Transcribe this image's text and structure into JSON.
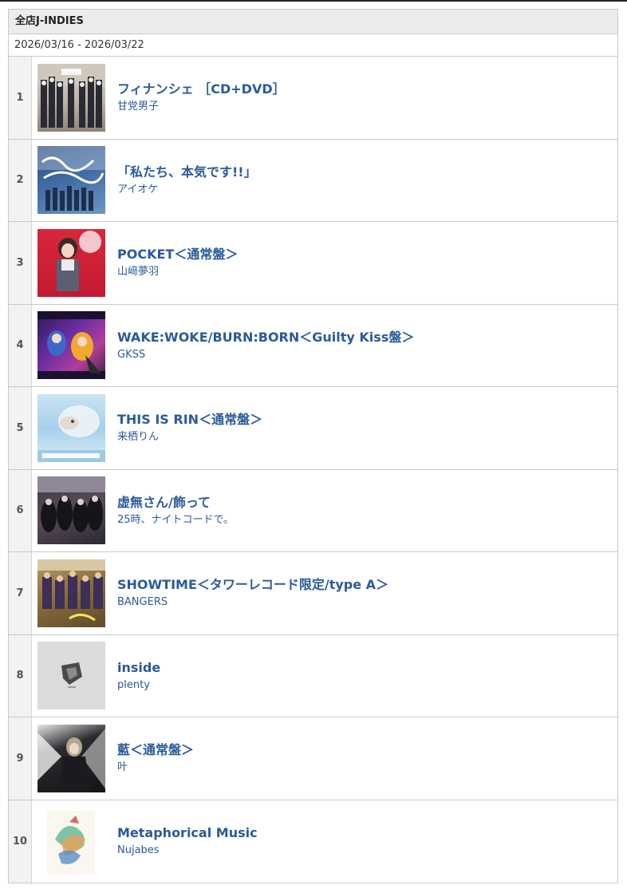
{
  "header": {
    "title": "全店J-INDIES",
    "date_range": "2026/03/16 - 2026/03/22"
  },
  "ranking": [
    {
      "rank": "1",
      "title": "フィナンシェ ［CD+DVD］",
      "artist": "甘党男子",
      "cover_icon": "album-cover-image"
    },
    {
      "rank": "2",
      "title": "「私たち、本気です!!」",
      "artist": "アイオケ",
      "cover_icon": "album-cover-image"
    },
    {
      "rank": "3",
      "title": "POCKET＜通常盤＞",
      "artist": "山﨑夢羽",
      "cover_icon": "album-cover-image"
    },
    {
      "rank": "4",
      "title": "WAKE:WOKE/BURN:BORN＜Guilty Kiss盤＞",
      "artist": "GKSS",
      "cover_icon": "album-cover-image"
    },
    {
      "rank": "5",
      "title": "THIS IS RIN＜通常盤＞",
      "artist": "来栖りん",
      "cover_icon": "album-cover-image"
    },
    {
      "rank": "6",
      "title": "虚無さん/飾って",
      "artist": "25時、ナイトコードで。",
      "cover_icon": "album-cover-image"
    },
    {
      "rank": "7",
      "title": "SHOWTIME＜タワーレコード限定/type A＞",
      "artist": "BANGERS",
      "cover_icon": "album-cover-image"
    },
    {
      "rank": "8",
      "title": "inside",
      "artist": "plenty",
      "cover_icon": "album-cover-image"
    },
    {
      "rank": "9",
      "title": "藍＜通常盤＞",
      "artist": "叶",
      "cover_icon": "album-cover-image"
    },
    {
      "rank": "10",
      "title": "Metaphorical Music",
      "artist": "Nujabes",
      "cover_icon": "album-cover-image"
    }
  ],
  "colors": {
    "link": "#2a5a9a",
    "border": "#c9c9c9",
    "header_bg": "#ececec"
  }
}
